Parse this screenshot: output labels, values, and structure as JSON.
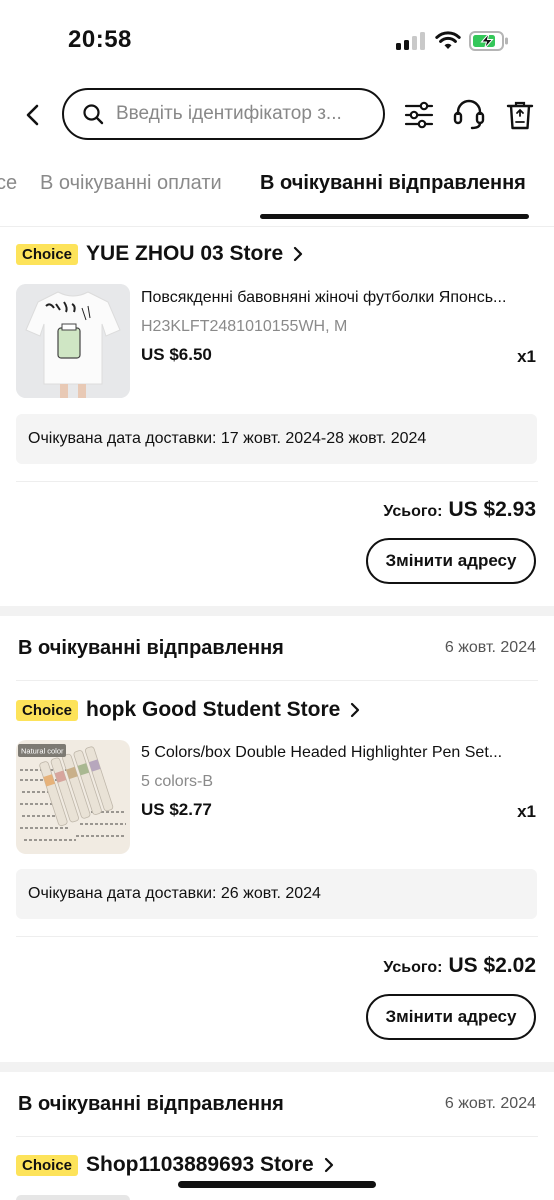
{
  "status_bar": {
    "time": "20:58"
  },
  "search": {
    "placeholder": "Введіть ідентифікатор з..."
  },
  "tabs": [
    {
      "label": "се"
    },
    {
      "label": "В очікуванні оплати"
    },
    {
      "label": "В очікуванні відправлення"
    }
  ],
  "orders": [
    {
      "badge": "Choice",
      "store": "YUE ZHOU 03 Store",
      "product": {
        "title": "Повсякденні бавовняні жіночі футболки Японсь...",
        "variant": "H23KLFT2481010155WH, M",
        "price": "US $6.50",
        "qty": "x1"
      },
      "delivery": "Очікувана дата доставки: 17 жовт. 2024-28 жовт. 2024",
      "total_label": "Усього:",
      "total_value": "US $2.93",
      "action": "Змінити адресу"
    },
    {
      "status": "В очікуванні відправлення",
      "date": "6 жовт. 2024",
      "badge": "Choice",
      "store": "hopk Good Student Store",
      "product": {
        "title": "5 Colors/box Double Headed Highlighter Pen Set...",
        "variant": "5 colors-B",
        "price": "US $2.77",
        "qty": "x1",
        "thumb_label": "Natural color"
      },
      "delivery": "Очікувана дата доставки: 26 жовт. 2024",
      "total_label": "Усього:",
      "total_value": "US $2.02",
      "action": "Змінити адресу"
    },
    {
      "status": "В очікуванні відправлення",
      "date": "6 жовт. 2024",
      "badge": "Choice",
      "store": "Shop1103889693 Store"
    }
  ],
  "colors": {
    "accent_badge": "#fde35a",
    "battery_green": "#34c759"
  }
}
